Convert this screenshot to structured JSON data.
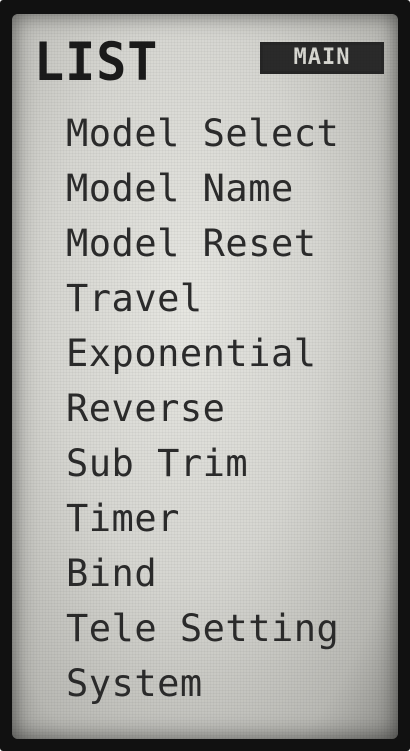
{
  "header": {
    "title": "LIST",
    "badge": "MAIN"
  },
  "menu": {
    "items": [
      {
        "label": "Model Select"
      },
      {
        "label": "Model Name"
      },
      {
        "label": "Model Reset"
      },
      {
        "label": "Travel"
      },
      {
        "label": "Exponential"
      },
      {
        "label": "Reverse"
      },
      {
        "label": "Sub Trim"
      },
      {
        "label": "Timer"
      },
      {
        "label": "Bind"
      },
      {
        "label": "Tele Setting"
      },
      {
        "label": "System"
      }
    ]
  }
}
